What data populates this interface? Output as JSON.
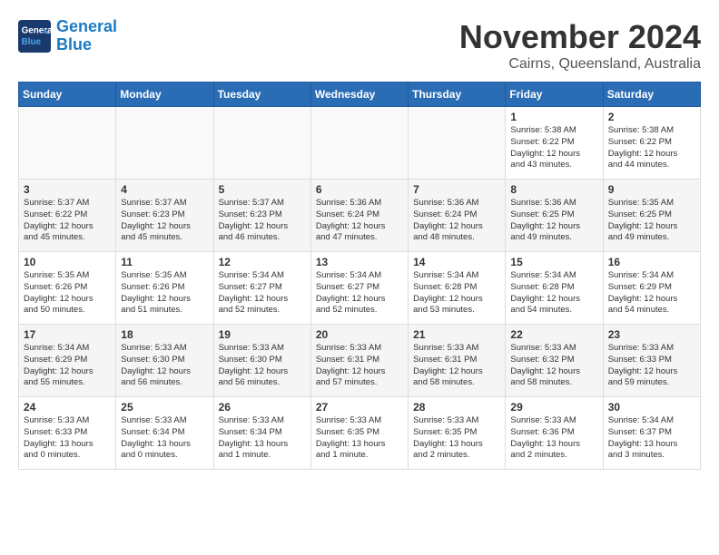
{
  "logo": {
    "line1": "General",
    "line2": "Blue"
  },
  "title": "November 2024",
  "location": "Cairns, Queensland, Australia",
  "days_of_week": [
    "Sunday",
    "Monday",
    "Tuesday",
    "Wednesday",
    "Thursday",
    "Friday",
    "Saturday"
  ],
  "weeks": [
    [
      {
        "day": "",
        "info": ""
      },
      {
        "day": "",
        "info": ""
      },
      {
        "day": "",
        "info": ""
      },
      {
        "day": "",
        "info": ""
      },
      {
        "day": "",
        "info": ""
      },
      {
        "day": "1",
        "info": "Sunrise: 5:38 AM\nSunset: 6:22 PM\nDaylight: 12 hours\nand 43 minutes."
      },
      {
        "day": "2",
        "info": "Sunrise: 5:38 AM\nSunset: 6:22 PM\nDaylight: 12 hours\nand 44 minutes."
      }
    ],
    [
      {
        "day": "3",
        "info": "Sunrise: 5:37 AM\nSunset: 6:22 PM\nDaylight: 12 hours\nand 45 minutes."
      },
      {
        "day": "4",
        "info": "Sunrise: 5:37 AM\nSunset: 6:23 PM\nDaylight: 12 hours\nand 45 minutes."
      },
      {
        "day": "5",
        "info": "Sunrise: 5:37 AM\nSunset: 6:23 PM\nDaylight: 12 hours\nand 46 minutes."
      },
      {
        "day": "6",
        "info": "Sunrise: 5:36 AM\nSunset: 6:24 PM\nDaylight: 12 hours\nand 47 minutes."
      },
      {
        "day": "7",
        "info": "Sunrise: 5:36 AM\nSunset: 6:24 PM\nDaylight: 12 hours\nand 48 minutes."
      },
      {
        "day": "8",
        "info": "Sunrise: 5:36 AM\nSunset: 6:25 PM\nDaylight: 12 hours\nand 49 minutes."
      },
      {
        "day": "9",
        "info": "Sunrise: 5:35 AM\nSunset: 6:25 PM\nDaylight: 12 hours\nand 49 minutes."
      }
    ],
    [
      {
        "day": "10",
        "info": "Sunrise: 5:35 AM\nSunset: 6:26 PM\nDaylight: 12 hours\nand 50 minutes."
      },
      {
        "day": "11",
        "info": "Sunrise: 5:35 AM\nSunset: 6:26 PM\nDaylight: 12 hours\nand 51 minutes."
      },
      {
        "day": "12",
        "info": "Sunrise: 5:34 AM\nSunset: 6:27 PM\nDaylight: 12 hours\nand 52 minutes."
      },
      {
        "day": "13",
        "info": "Sunrise: 5:34 AM\nSunset: 6:27 PM\nDaylight: 12 hours\nand 52 minutes."
      },
      {
        "day": "14",
        "info": "Sunrise: 5:34 AM\nSunset: 6:28 PM\nDaylight: 12 hours\nand 53 minutes."
      },
      {
        "day": "15",
        "info": "Sunrise: 5:34 AM\nSunset: 6:28 PM\nDaylight: 12 hours\nand 54 minutes."
      },
      {
        "day": "16",
        "info": "Sunrise: 5:34 AM\nSunset: 6:29 PM\nDaylight: 12 hours\nand 54 minutes."
      }
    ],
    [
      {
        "day": "17",
        "info": "Sunrise: 5:34 AM\nSunset: 6:29 PM\nDaylight: 12 hours\nand 55 minutes."
      },
      {
        "day": "18",
        "info": "Sunrise: 5:33 AM\nSunset: 6:30 PM\nDaylight: 12 hours\nand 56 minutes."
      },
      {
        "day": "19",
        "info": "Sunrise: 5:33 AM\nSunset: 6:30 PM\nDaylight: 12 hours\nand 56 minutes."
      },
      {
        "day": "20",
        "info": "Sunrise: 5:33 AM\nSunset: 6:31 PM\nDaylight: 12 hours\nand 57 minutes."
      },
      {
        "day": "21",
        "info": "Sunrise: 5:33 AM\nSunset: 6:31 PM\nDaylight: 12 hours\nand 58 minutes."
      },
      {
        "day": "22",
        "info": "Sunrise: 5:33 AM\nSunset: 6:32 PM\nDaylight: 12 hours\nand 58 minutes."
      },
      {
        "day": "23",
        "info": "Sunrise: 5:33 AM\nSunset: 6:33 PM\nDaylight: 12 hours\nand 59 minutes."
      }
    ],
    [
      {
        "day": "24",
        "info": "Sunrise: 5:33 AM\nSunset: 6:33 PM\nDaylight: 13 hours\nand 0 minutes."
      },
      {
        "day": "25",
        "info": "Sunrise: 5:33 AM\nSunset: 6:34 PM\nDaylight: 13 hours\nand 0 minutes."
      },
      {
        "day": "26",
        "info": "Sunrise: 5:33 AM\nSunset: 6:34 PM\nDaylight: 13 hours\nand 1 minute."
      },
      {
        "day": "27",
        "info": "Sunrise: 5:33 AM\nSunset: 6:35 PM\nDaylight: 13 hours\nand 1 minute."
      },
      {
        "day": "28",
        "info": "Sunrise: 5:33 AM\nSunset: 6:35 PM\nDaylight: 13 hours\nand 2 minutes."
      },
      {
        "day": "29",
        "info": "Sunrise: 5:33 AM\nSunset: 6:36 PM\nDaylight: 13 hours\nand 2 minutes."
      },
      {
        "day": "30",
        "info": "Sunrise: 5:34 AM\nSunset: 6:37 PM\nDaylight: 13 hours\nand 3 minutes."
      }
    ]
  ]
}
